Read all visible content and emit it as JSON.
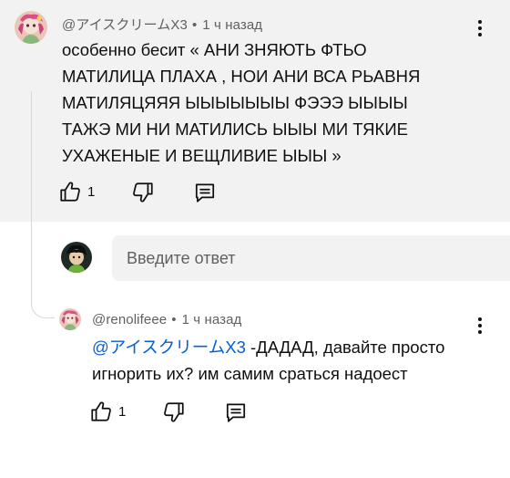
{
  "comment": {
    "author": "@アイスクリームX3",
    "time": "1 ч назад",
    "text": "особенно бесит « АНИ ЗНЯЮТЬ ФТЬО\nМАТИЛИЦА ПЛАХА , НОИ АНИ ВСА РЬАВНЯ\nМАТИЛЯЦЯЯЯ ЫЫЫЫЫЫЫ ФЭЭЭ ЫЫЫЫ\nТАЖЭ МИ НИ МАТИЛИСЬ ЫЫЫ МИ ТЯКИЕ\nУХАЖЕНЫЕ И ВЕЩЛИВИЕ ЫЫЫ »",
    "like_count": "1",
    "icons": {
      "like": "thumb-up-icon",
      "dislike": "thumb-down-icon",
      "reply": "comment-reply-icon",
      "menu": "more-vert-icon"
    }
  },
  "reply_box": {
    "placeholder": "Введите ответ"
  },
  "reply": {
    "author": "@renolifeee",
    "time": "1 ч назад",
    "mention": "@アイスクリームX3",
    "text": " -ДАДАД, давайте просто игнорить их? им самим сраться надоест",
    "like_count": "1"
  },
  "colors": {
    "highlight_bg": "#f2f2f2",
    "meta_text": "#606060",
    "mention_link": "#065fd4",
    "text": "#0f0f0f"
  }
}
